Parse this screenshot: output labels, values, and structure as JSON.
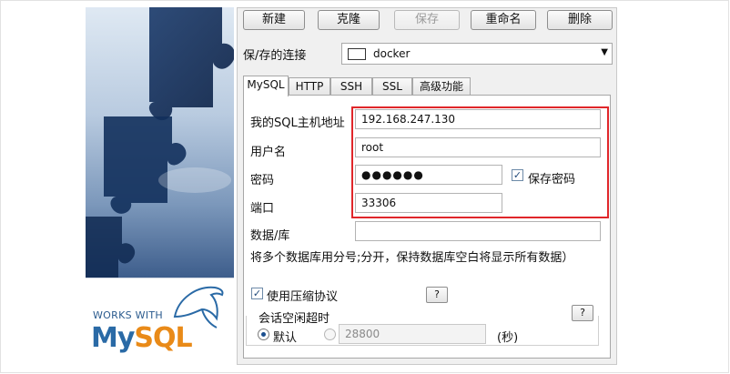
{
  "toolbar": {
    "new": "新建",
    "clone": "克隆",
    "save": "保存",
    "rename": "重命名",
    "delete": "删除"
  },
  "connection": {
    "label": "保/存的连接",
    "selected": "docker"
  },
  "tabs": [
    "MySQL",
    "HTTP",
    "SSH",
    "SSL",
    "高级功能"
  ],
  "form": {
    "host_label": "我的SQL主机地址",
    "host_value": "192.168.247.130",
    "user_label": "用户名",
    "user_value": "root",
    "password_label": "密码",
    "password_value": "●●●●●●",
    "save_password_label": "保存密码",
    "port_label": "端口",
    "port_value": "33306",
    "database_label": "数据/库",
    "database_value": "",
    "database_hint": "将多个数据库用分号;分开，保持数据库空白将显示所有数据）",
    "compress_label": "使用压缩协议",
    "help_label": "?",
    "timeout_group_label": "会话空闲超时",
    "default_label": "默认",
    "timeout_value": "28800",
    "seconds_label": "(秒)"
  },
  "branding": {
    "works_with": "WORKS WITH",
    "logo_my": "My",
    "logo_sql": "SQL"
  },
  "colors": {
    "highlight": "#e0262a",
    "logo_blue": "#2a6aa6",
    "logo_orange": "#e98a18"
  }
}
